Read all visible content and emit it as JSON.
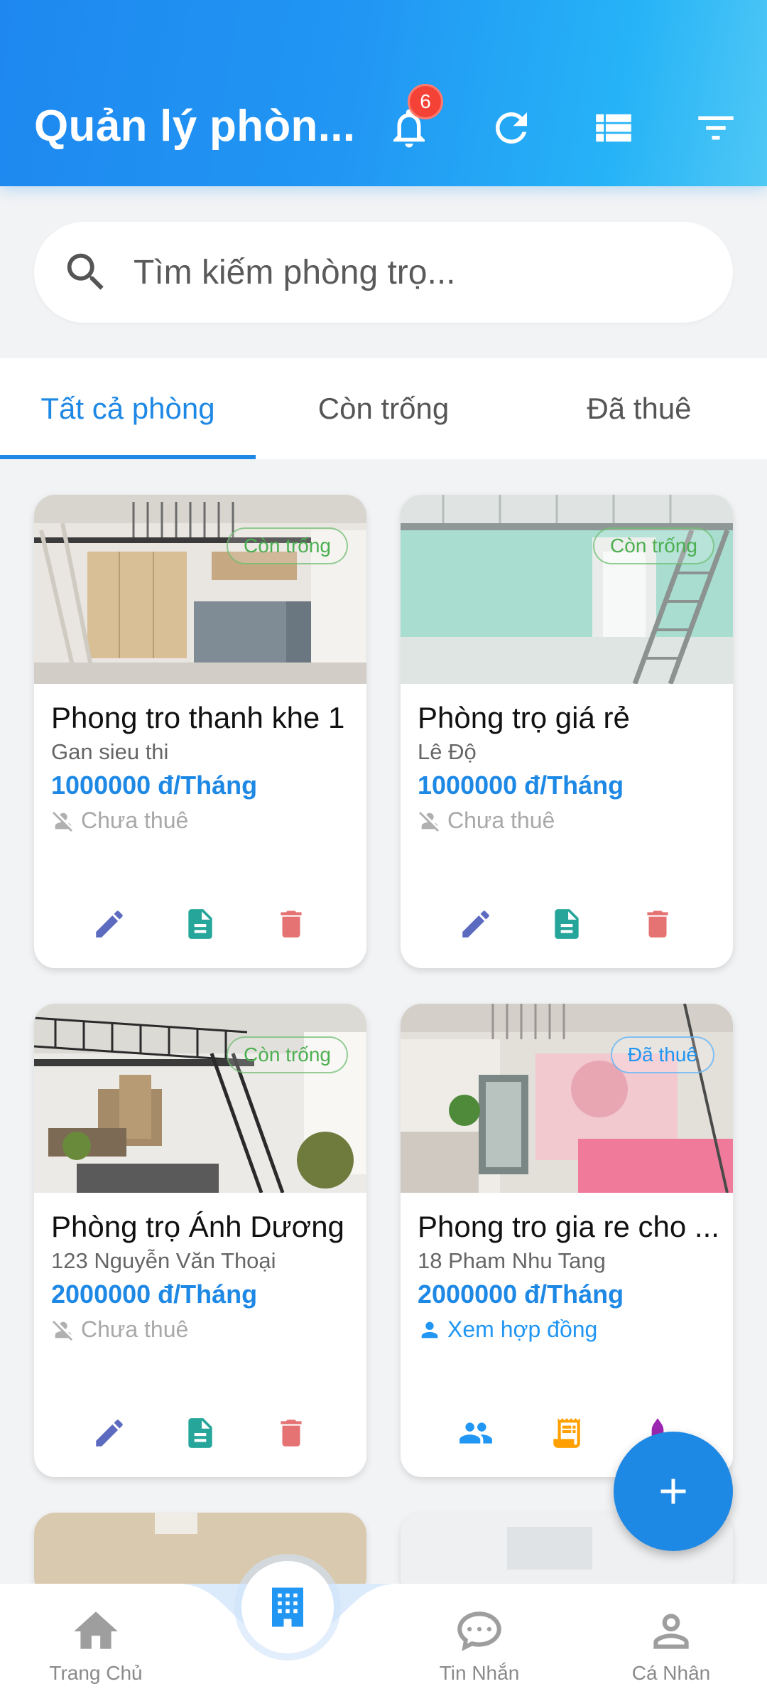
{
  "header": {
    "title": "Quản lý phòn...",
    "notification_count": "6",
    "icons": [
      "bell-icon",
      "refresh-icon",
      "list-view-icon",
      "filter-icon"
    ]
  },
  "search": {
    "placeholder": "Tìm kiếm phòng trọ..."
  },
  "tabs": [
    {
      "label": "Tất cả phòng",
      "active": true
    },
    {
      "label": "Còn trống",
      "active": false
    },
    {
      "label": "Đã thuê",
      "active": false
    }
  ],
  "rooms": [
    {
      "status": "Còn trống",
      "name": "Phong tro thanh khe 1",
      "address": "Gan sieu thi",
      "price": "1000000 đ/Tháng",
      "state": "Chưa thuê"
    },
    {
      "status": "Còn trống",
      "name": "Phòng trọ giá rẻ",
      "address": "Lê Độ",
      "price": "1000000 đ/Tháng",
      "state": "Chưa thuê"
    },
    {
      "status": "Còn trống",
      "name": "Phòng trọ Ánh Dương",
      "address": "123 Nguyễn Văn Thoại",
      "price": "2000000 đ/Tháng",
      "state": "Chưa thuê"
    },
    {
      "status": "Đã thuê",
      "name": "Phong tro gia re cho ...",
      "address": "18 Pham Nhu Tang",
      "price": "2000000 đ/Tháng",
      "state": "Xem hợp đồng"
    }
  ],
  "bottom_nav": [
    {
      "label": "Trang Chủ",
      "icon": "home-icon"
    },
    {
      "label": "",
      "icon": "building-icon"
    },
    {
      "label": "Tin Nhắn",
      "icon": "chat-icon"
    },
    {
      "label": "Cá Nhân",
      "icon": "person-icon"
    }
  ],
  "colors": {
    "primary": "#1e88e5",
    "free": "#4caf50",
    "edit": "#5c6bc0",
    "doc": "#26a69a",
    "delete": "#e57373",
    "invoice": "#ffa000",
    "people": "#2196f3"
  }
}
